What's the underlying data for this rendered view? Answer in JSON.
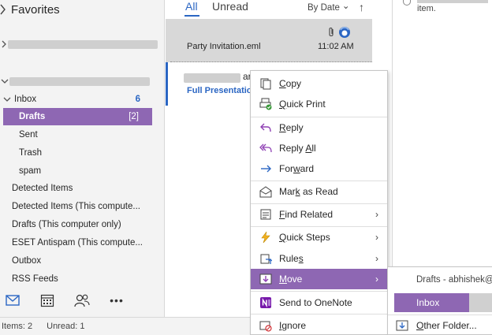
{
  "folder_pane": {
    "favorites_label": "Favorites",
    "inbox": {
      "label": "Inbox",
      "count": "6"
    },
    "folders": [
      {
        "label": "Drafts",
        "count": "[2]",
        "selected": true
      },
      {
        "label": "Sent"
      },
      {
        "label": "Trash"
      },
      {
        "label": "spam"
      }
    ],
    "root_folders": [
      {
        "label": "Detected Items"
      },
      {
        "label": "Detected Items (This compute..."
      },
      {
        "label": "Drafts (This computer only)"
      },
      {
        "label": "ESET Antispam (This compute..."
      },
      {
        "label": "Outbox"
      },
      {
        "label": "RSS Feeds"
      }
    ],
    "nav_icons": [
      "mail-icon",
      "calendar-icon",
      "people-icon",
      "more-icon"
    ],
    "more_glyph": "•••"
  },
  "status_bar": {
    "items": "Items: 2",
    "unread": "Unread: 1"
  },
  "message_list": {
    "tabs": {
      "all": "All",
      "unread": "Unread"
    },
    "sort": {
      "label": "By Date",
      "caret": "⌄",
      "direction": "↑"
    },
    "items": [
      {
        "subject": "Party Invitation.eml",
        "time": "11:02 AM"
      },
      {
        "from_tail": "ar",
        "subject": "Full Presentation"
      }
    ]
  },
  "reading_pane": {
    "note": "item."
  },
  "context_menu": {
    "items": [
      {
        "label": "Copy",
        "icon": "copy-icon",
        "access_key": "C"
      },
      {
        "label": "Quick Print",
        "icon": "print-icon",
        "access_key": "Q"
      },
      {
        "label": "Reply",
        "icon": "reply-icon",
        "access_key": "R"
      },
      {
        "label": "Reply All",
        "icon": "reply-all-icon",
        "access_key": "A"
      },
      {
        "label": "Forward",
        "icon": "forward-icon",
        "access_key": "w"
      },
      {
        "label": "Mark as Read",
        "icon": "envelope-open-icon",
        "access_key": "k"
      },
      {
        "label": "Find Related",
        "icon": "find-related-icon",
        "access_key": "F",
        "submenu": true
      },
      {
        "label": "Quick Steps",
        "icon": "lightning-icon",
        "access_key": "Q",
        "submenu": true
      },
      {
        "label": "Rules",
        "icon": "rules-icon",
        "access_key": "s",
        "submenu": true
      },
      {
        "label": "Move",
        "icon": "move-icon",
        "access_key": "M",
        "submenu": true,
        "active": true
      },
      {
        "label": "Send to OneNote",
        "icon": "onenote-icon"
      },
      {
        "label": "Ignore",
        "icon": "ignore-icon",
        "access_key": "I"
      }
    ],
    "submenu_arrow": "›"
  },
  "move_submenu": {
    "header": "Drafts - abhishek@",
    "inbox_label": "Inbox",
    "other_folder_label": "Other Folder..."
  },
  "colors": {
    "accent": "#2b66c3",
    "selection": "#8e67b3"
  }
}
